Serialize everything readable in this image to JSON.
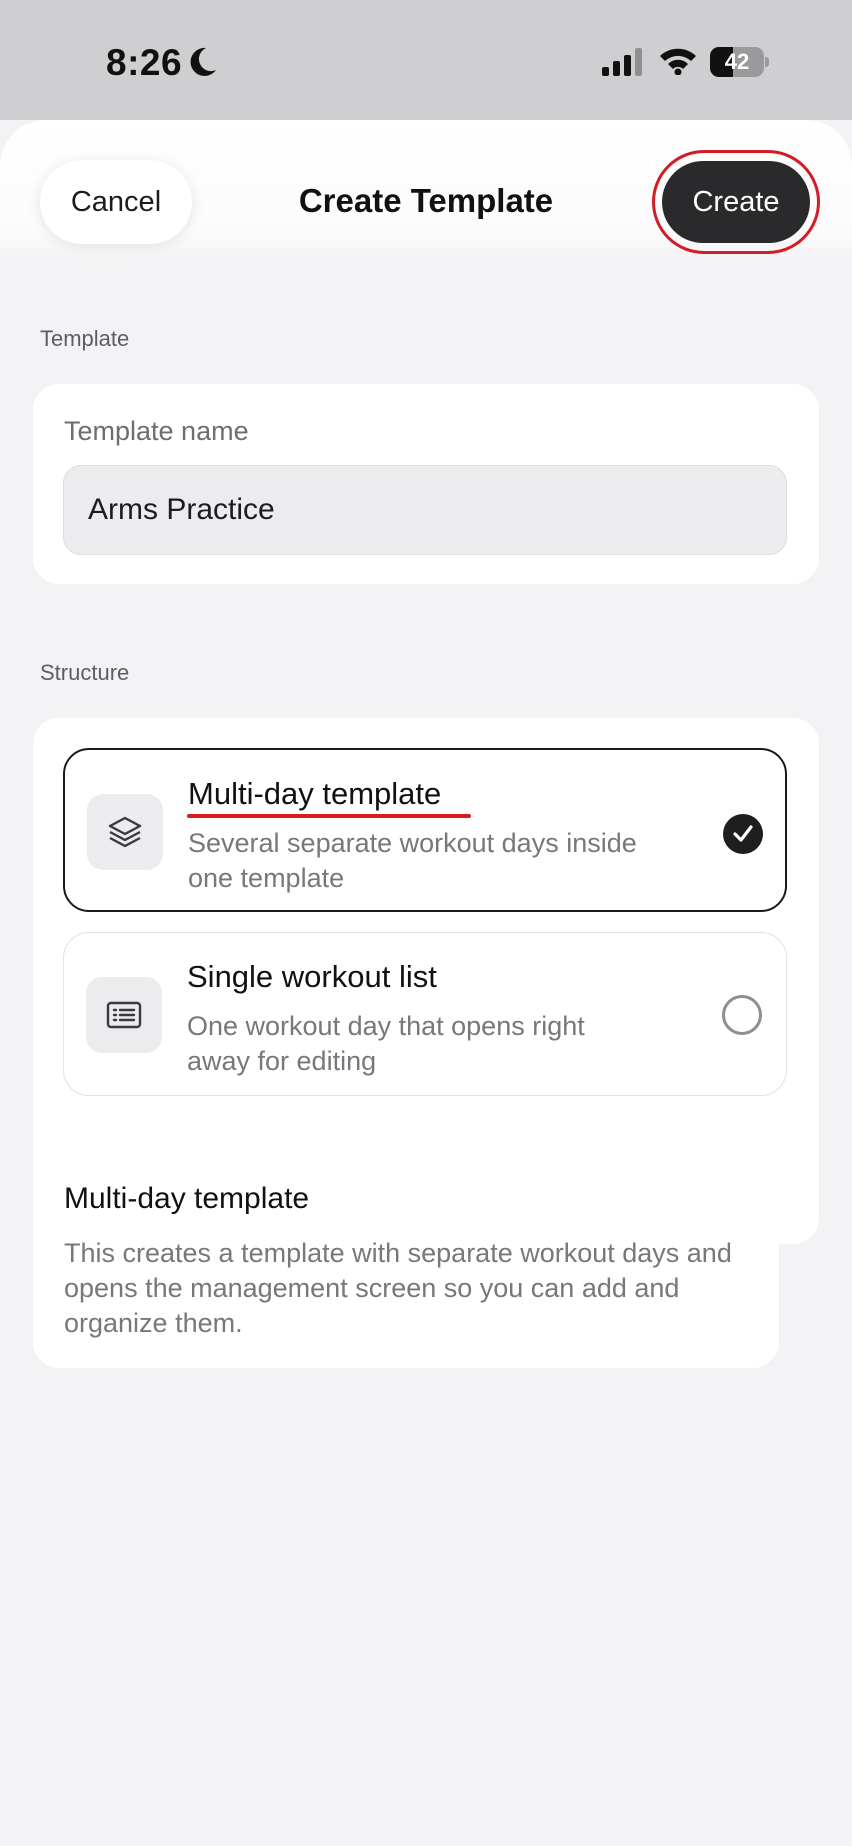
{
  "status_bar": {
    "time": "8:26",
    "battery_level": "42",
    "battery_fraction": 0.42
  },
  "nav": {
    "cancel_label": "Cancel",
    "title": "Create Template",
    "create_label": "Create",
    "highlight_color": "#d41c25"
  },
  "template_section": {
    "header": "Template",
    "field_label": "Template name",
    "field_value": "Arms Practice"
  },
  "structure_section": {
    "header": "Structure",
    "options": [
      {
        "title": "Multi-day template",
        "description": "Several separate workout days inside one template",
        "icon": "layers-icon",
        "selected": true
      },
      {
        "title": "Single workout list",
        "description": "One workout day that opens right away for editing",
        "icon": "list-icon",
        "selected": false
      }
    ]
  },
  "info_card": {
    "title": "Multi-day template",
    "body": "This creates a template with separate workout days and opens the management screen so you can add and organize them."
  }
}
